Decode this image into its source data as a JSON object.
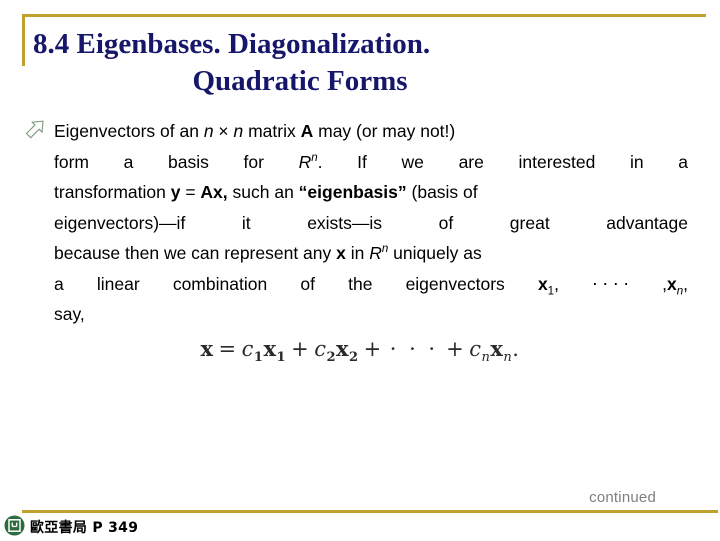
{
  "slide": {
    "accent_gold": "#BFA12E",
    "title_color": "#16166B",
    "body_color": "#000000",
    "continued_color": "#7E7E7E",
    "logo_color": "#2E6B3E"
  },
  "title": {
    "line1": "8.4  Eigenbases. Diagonalization.",
    "line2": "Quadratic Forms"
  },
  "bullet": {
    "icon": "diagonal-arrow-bullet-icon"
  },
  "paragraph": {
    "line1": {
      "a": "Eigenvectors of an ",
      "n1": "n",
      "times": " × ",
      "n2": "n",
      "b": " matrix ",
      "A": "A",
      "c": " may (or may not!)"
    },
    "line2": {
      "a": "form",
      "b": "a",
      "c": "basis",
      "d": "for",
      "R": "R",
      "Rsup": "n",
      "e": ".",
      "f": "If",
      "g": "we",
      "h": "are",
      "i": "interested",
      "j": "in",
      "k": "a"
    },
    "line3": {
      "a": "transformation ",
      "y": "y",
      "eq": " = ",
      "Ax": "Ax,",
      "b": " such an ",
      "eigenbasis": "“eigenbasis”",
      "c": " (basis of"
    },
    "line4": {
      "a": "eigenvectors)—if",
      "b": "it",
      "c": "exists—is",
      "d": "of",
      "e": "great",
      "f": "advantage"
    },
    "line5": {
      "a": "because then we can represent any ",
      "x": "x",
      "b": " in ",
      "R": "R",
      "Rsup": "n",
      "c": " uniquely as"
    },
    "line6": {
      "a": "a",
      "b": "linear",
      "c": "combination",
      "d": "of",
      "e": "the",
      "f": "eigenvectors",
      "x1": "x",
      "x1sub": "1",
      "comma1": ",",
      "dots": "⋅ ⋅ ⋅ ⋅",
      "comma2": ",",
      "xn": "x",
      "xnsub": "n",
      "comma3": ","
    },
    "line7": "say,"
  },
  "equation": {
    "x": "x",
    "equals": "=",
    "c1": "c",
    "c1sub": "1",
    "x1": "x",
    "x1sub": "1",
    "plus1": "+",
    "c2": "c",
    "c2sub": "2",
    "x2": "x",
    "x2sub": "2",
    "plus2": "+",
    "dots": "· · ·",
    "plus3": "+",
    "cn": "c",
    "cnsub": "n",
    "xn": "x",
    "xnsub": "n",
    "period": "."
  },
  "footer": {
    "continued": "continued",
    "publisher": "歐亞書局 P 349"
  }
}
